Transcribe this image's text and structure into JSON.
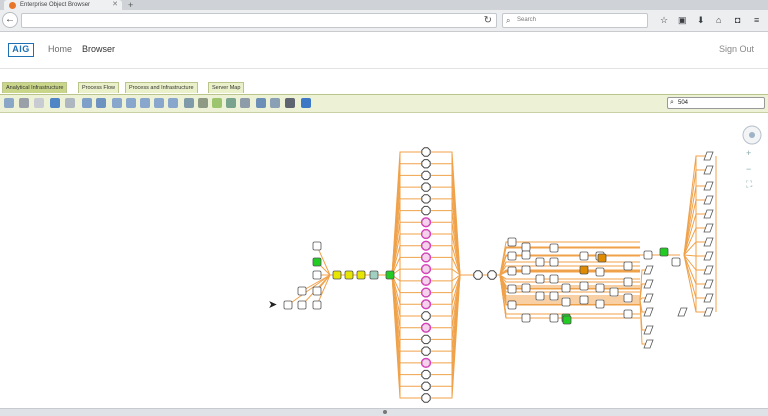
{
  "browser": {
    "tab_title": "Enterprise Object Browser",
    "search_placeholder": "Search",
    "new_tab": "+"
  },
  "app": {
    "logo": "AIG",
    "nav_home": "Home",
    "nav_browser": "Browser",
    "sign_out": "Sign Out"
  },
  "view_tabs": [
    {
      "label": "Analytical Infrastructure",
      "active": true
    },
    {
      "label": "Process Flow",
      "active": false
    },
    {
      "label": "Process and Infrastructure",
      "active": false
    },
    {
      "label": "Server Map",
      "active": false
    }
  ],
  "find": {
    "value": "504"
  },
  "zoom_controls": [
    "pan",
    "zoom-in",
    "zoom-out",
    "fit"
  ],
  "colors": {
    "edge": "#f0a24a",
    "highlight_green": "#22cc22",
    "highlight_yellow": "#e6e600",
    "highlight_pink": "#e040c0",
    "highlight_orange": "#e08a00",
    "toolbar_bg": "#edf1d6"
  }
}
